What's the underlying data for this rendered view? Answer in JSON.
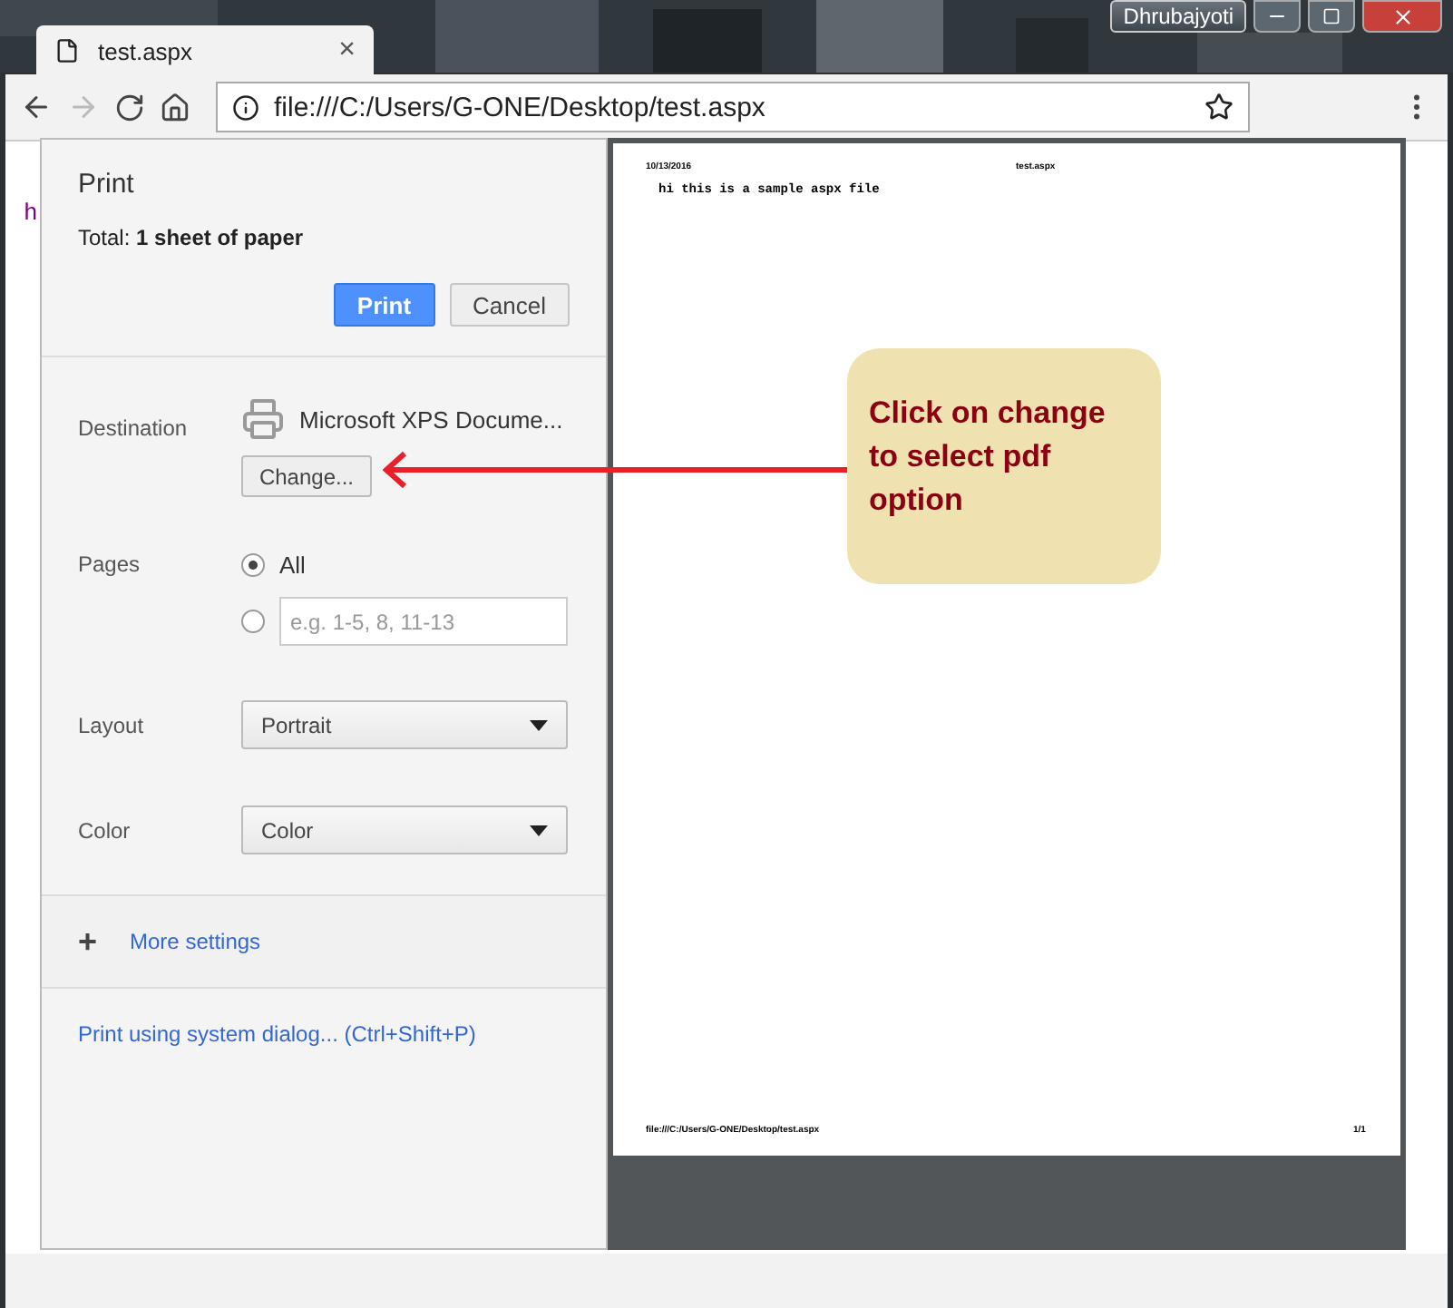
{
  "titlebar": {
    "user": "Dhrubajyoti"
  },
  "tabs": [
    {
      "label": "test.aspx",
      "close": "×",
      "selected": true
    }
  ],
  "address": {
    "url": "file:///C:/Users/G-ONE/Desktop/test.aspx"
  },
  "page_peek": "h",
  "print_dialog": {
    "title": "Print",
    "total_label": "Total:",
    "total_value": "1 sheet of paper",
    "buttons": [
      {
        "label": "Print",
        "primary": true
      },
      {
        "label": "Cancel",
        "primary": false
      }
    ],
    "destination": {
      "label": "Destination",
      "printer": "Microsoft XPS Docume...",
      "change": "Change..."
    },
    "pages": {
      "label": "Pages",
      "options": [
        {
          "label": "All",
          "selected": true,
          "kind": "text"
        },
        {
          "placeholder": "e.g. 1-5, 8, 11-13",
          "selected": false,
          "kind": "field"
        }
      ]
    },
    "layout": {
      "label": "Layout",
      "value": "Portrait"
    },
    "color": {
      "label": "Color",
      "value": "Color"
    },
    "more_settings": {
      "icon": "+",
      "label": "More settings"
    },
    "system_dialog": "Print using system dialog... (Ctrl+Shift+P)"
  },
  "preview": {
    "header_left": "10/13/2016",
    "header_center": "test.aspx",
    "body": "hi this is a sample aspx file",
    "footer_left": "file:///C:/Users/G-ONE/Desktop/test.aspx",
    "footer_right": "1/1"
  },
  "callout": {
    "text": "Click on change to select pdf option"
  }
}
